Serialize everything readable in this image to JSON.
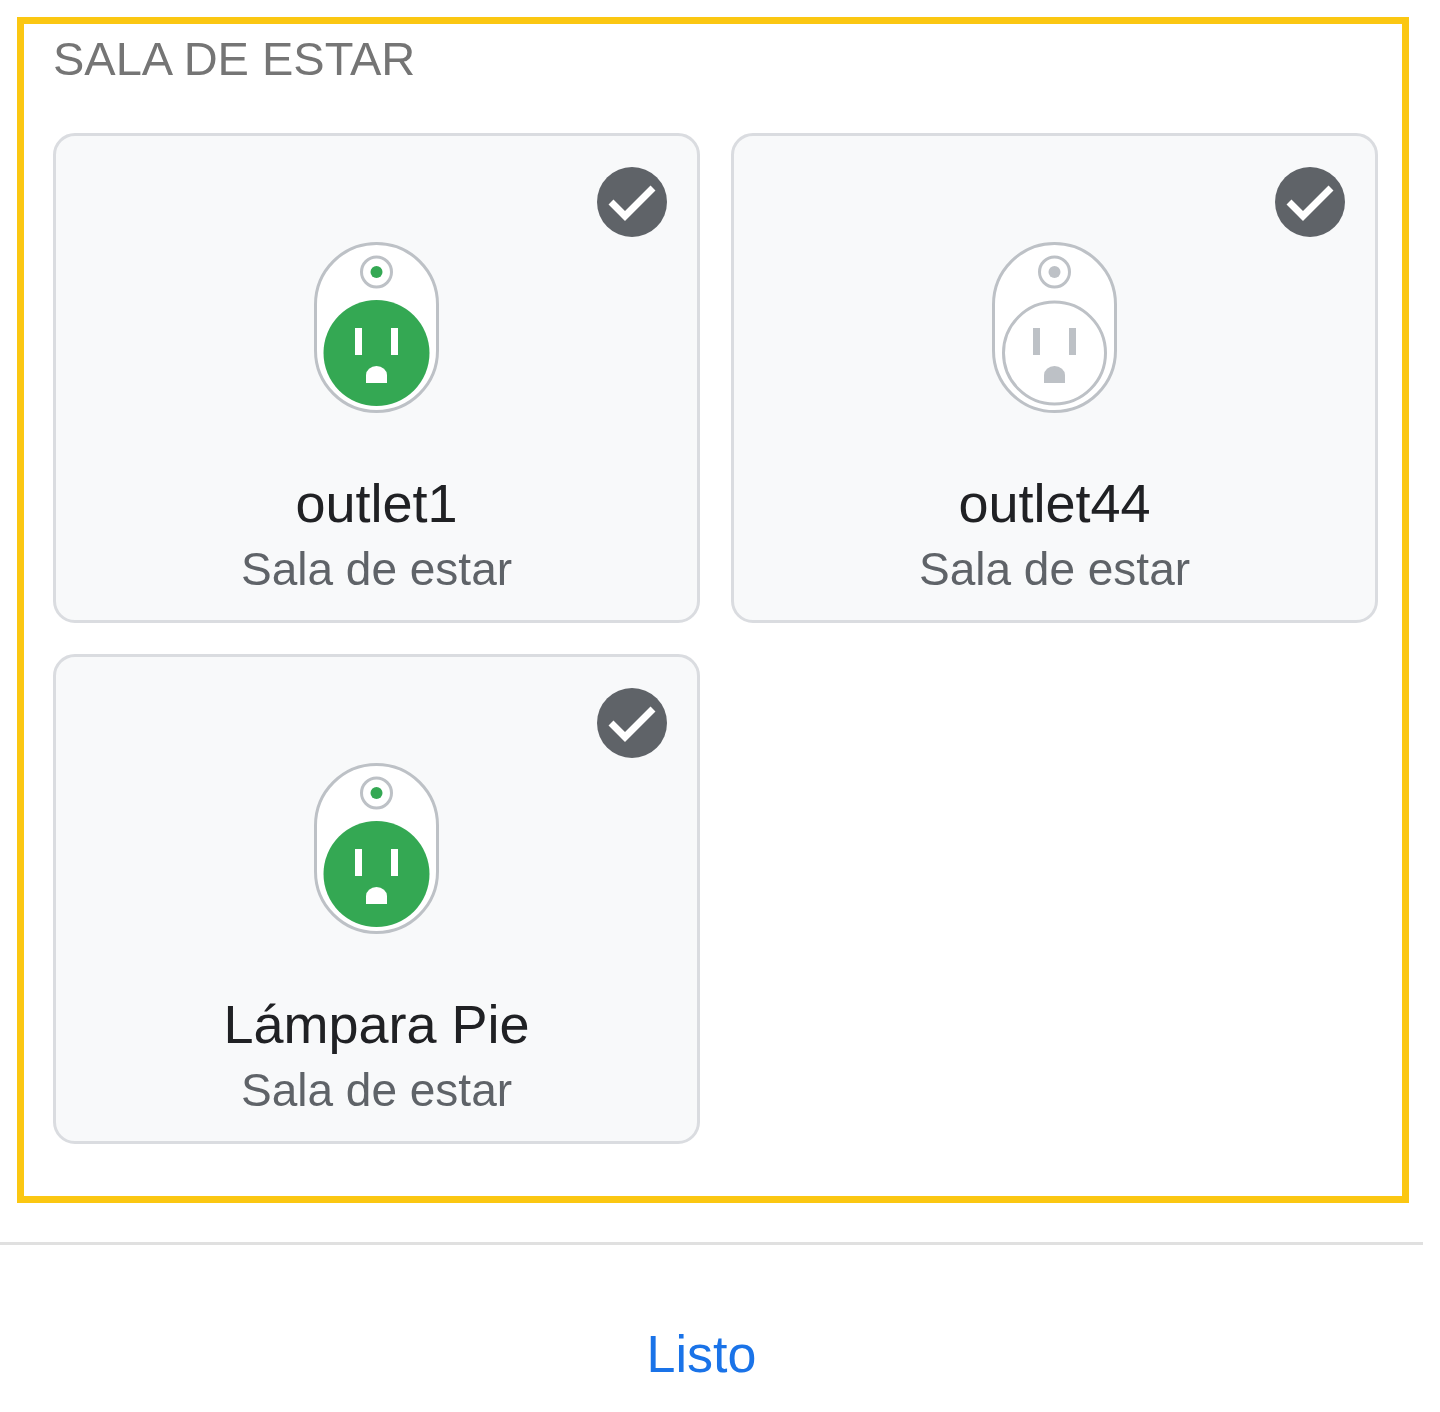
{
  "section": {
    "title": "SALA DE ESTAR",
    "highlighted": true,
    "devices": [
      {
        "name": "outlet1",
        "room": "Sala de estar",
        "on": true,
        "selected": true
      },
      {
        "name": "outlet44",
        "room": "Sala de estar",
        "on": false,
        "selected": true
      },
      {
        "name": "Lámpara Pie",
        "room": "Sala de estar",
        "on": true,
        "selected": true
      }
    ]
  },
  "footer": {
    "button": "Listo"
  }
}
